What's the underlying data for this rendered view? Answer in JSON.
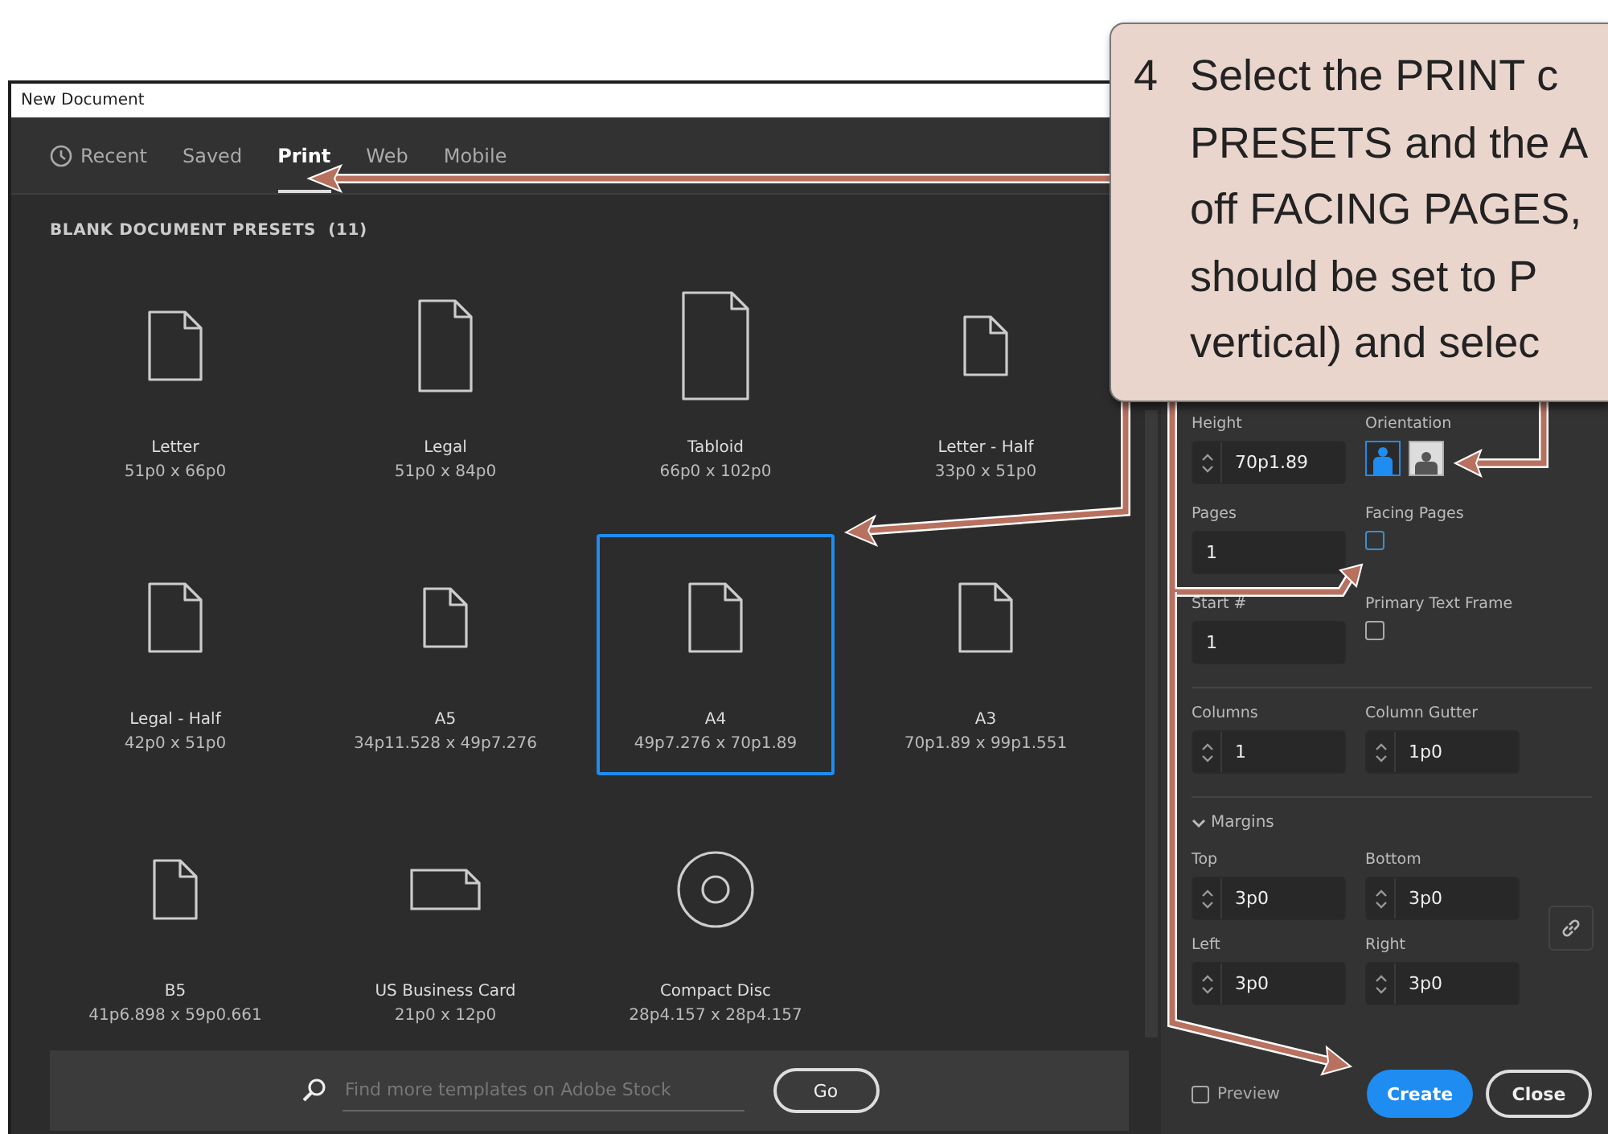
{
  "window": {
    "title": "New Document"
  },
  "tabs": [
    {
      "label": "Recent",
      "selected": false
    },
    {
      "label": "Saved",
      "selected": false
    },
    {
      "label": "Print",
      "selected": true
    },
    {
      "label": "Web",
      "selected": false
    },
    {
      "label": "Mobile",
      "selected": false
    }
  ],
  "presets": {
    "heading": "BLANK DOCUMENT PRESETS",
    "count": "(11)",
    "items": [
      {
        "name": "Letter",
        "size": "51p0 x 66p0",
        "kind": "page",
        "selected": false
      },
      {
        "name": "Legal",
        "size": "51p0 x 84p0",
        "kind": "tall",
        "selected": false
      },
      {
        "name": "Tabloid",
        "size": "66p0 x 102p0",
        "kind": "large",
        "selected": false
      },
      {
        "name": "Letter - Half",
        "size": "33p0 x 51p0",
        "kind": "small",
        "selected": false
      },
      {
        "name": "Legal - Half",
        "size": "42p0 x 51p0",
        "kind": "page",
        "selected": false
      },
      {
        "name": "A5",
        "size": "34p11.528 x 49p7.276",
        "kind": "small",
        "selected": false
      },
      {
        "name": "A4",
        "size": "49p7.276 x 70p1.89",
        "kind": "page",
        "selected": true
      },
      {
        "name": "A3",
        "size": "70p1.89 x 99p1.551",
        "kind": "page",
        "selected": false
      },
      {
        "name": "B5",
        "size": "41p6.898 x 59p0.661",
        "kind": "small",
        "selected": false
      },
      {
        "name": "US Business Card",
        "size": "21p0 x 12p0",
        "kind": "card",
        "selected": false
      },
      {
        "name": "Compact Disc",
        "size": "28p4.157 x 28p4.157",
        "kind": "disc",
        "selected": false
      }
    ]
  },
  "stock_search": {
    "placeholder": "Find more templates on Adobe Stock",
    "button": "Go"
  },
  "settings": {
    "height": {
      "label": "Height",
      "value": "70p1.89"
    },
    "orientation": {
      "label": "Orientation",
      "options": [
        {
          "kind": "portrait",
          "selected": true
        },
        {
          "kind": "landscape",
          "selected": false
        }
      ]
    },
    "pages": {
      "label": "Pages",
      "value": "1"
    },
    "facing_pages": {
      "label": "Facing Pages",
      "checked": false
    },
    "start": {
      "label": "Start #",
      "value": "1"
    },
    "primary_text_frame": {
      "label": "Primary Text Frame",
      "checked": false
    },
    "columns": {
      "label": "Columns",
      "value": "1"
    },
    "column_gutter": {
      "label": "Column Gutter",
      "value": "1p0"
    },
    "margins": {
      "label": "Margins",
      "expanded": true,
      "fields": [
        {
          "label": "Top",
          "value": "3p0"
        },
        {
          "label": "Bottom",
          "value": "3p0"
        },
        {
          "label": "Left",
          "value": "3p0"
        },
        {
          "label": "Right",
          "value": "3p0"
        }
      ]
    }
  },
  "footer": {
    "preview": {
      "label": "Preview",
      "checked": false
    },
    "create": "Create",
    "close": "Close"
  },
  "callout": {
    "step": "4",
    "lines": [
      "Select the PRINT c",
      "PRESETS and the A",
      "off FACING PAGES,",
      "should be set to P",
      "vertical) and selec"
    ]
  }
}
